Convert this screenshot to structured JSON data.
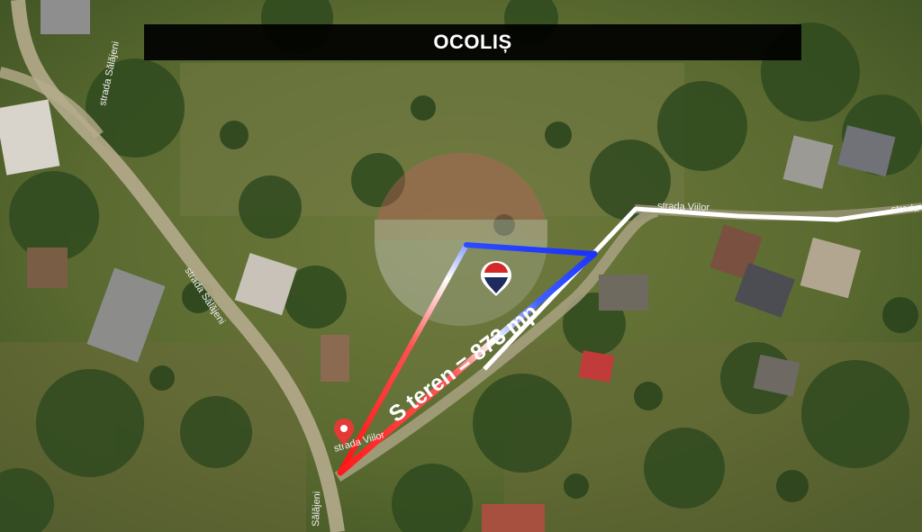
{
  "title": "OCOLIȘ",
  "area_label": "S teren = 873 mp",
  "streets": {
    "salajeni_top": "strada Sălăjeni",
    "salajeni_mid": "strada Sălăjeni",
    "salajeni_bottom": "Sălăjeni",
    "viilor_top": "strada Viilor",
    "viilor_bottom": "strada Viilor",
    "viilor_edge": "strada"
  },
  "colors": {
    "parcel_red": "#ff1a1a",
    "parcel_blue": "#1a3cff",
    "road_white": "#ffffff",
    "pin_red": "#e53935",
    "brand_red": "#d62828",
    "brand_navy": "#1d2b5e"
  },
  "icons": {
    "location_pin": "map-pin-icon",
    "brand_logo": "remax-balloon-icon"
  }
}
